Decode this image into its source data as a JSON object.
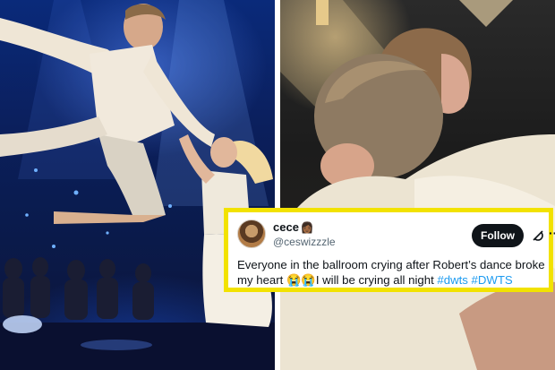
{
  "tweet": {
    "display_name": "cece",
    "name_emoji": "👩🏾",
    "handle": "@ceswizzzle",
    "follow_label": "Follow",
    "more_label": "···",
    "text_part1": "Everyone in the ballroom crying after Robert’s dance broke my heart ",
    "emojis": "😭😭",
    "text_part2": "I will be crying all night ",
    "hashtag1": "#dwts",
    "hashtag2": "#DWTS"
  },
  "colors": {
    "highlight_border": "#f2e200",
    "follow_button": "#0f1419",
    "hashtag": "#1d9bf0",
    "handle": "#536471"
  },
  "icons": {
    "grok": "grok-icon",
    "more": "more-icon",
    "avatar": "avatar"
  }
}
